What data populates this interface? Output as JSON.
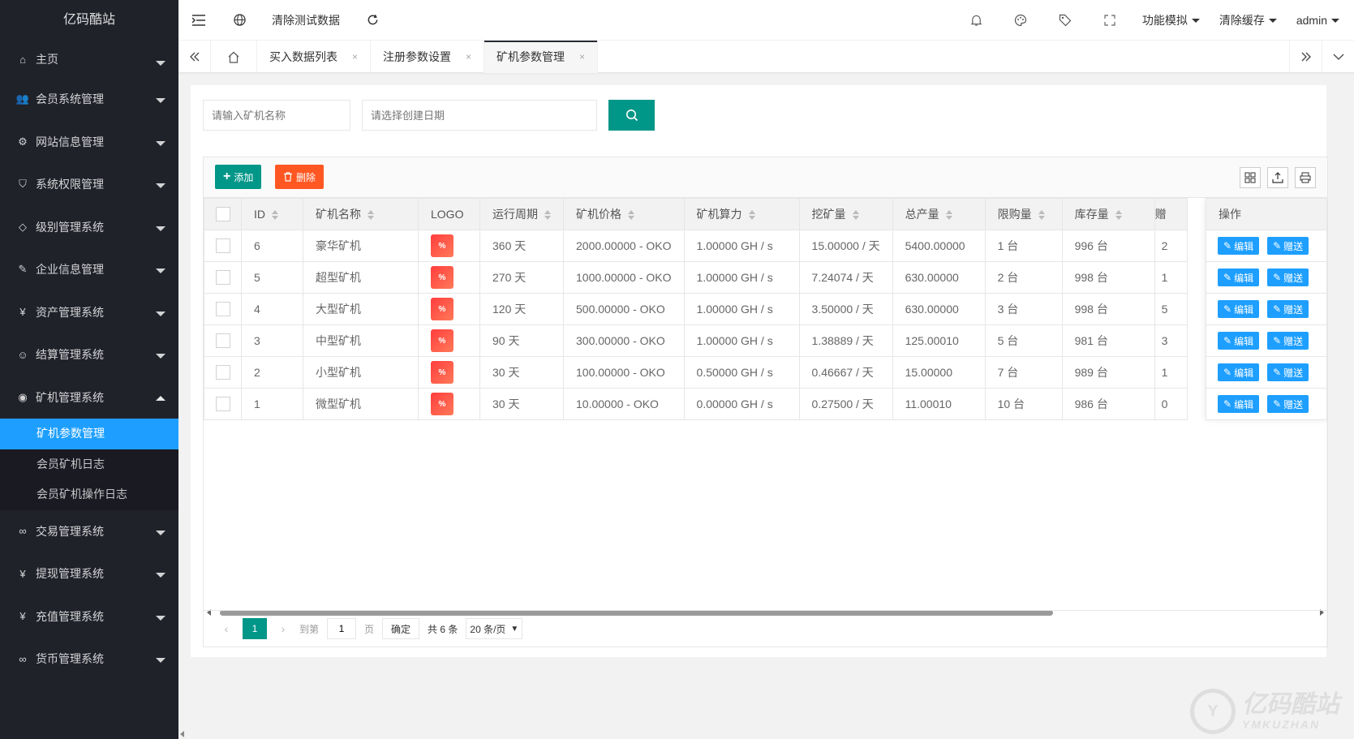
{
  "sidebar": {
    "logo": "亿码酷站",
    "items": [
      {
        "label": "主页",
        "icon": "home-icon"
      },
      {
        "label": "会员系统管理",
        "icon": "users-icon"
      },
      {
        "label": "网站信息管理",
        "icon": "gear-icon"
      },
      {
        "label": "系统权限管理",
        "icon": "shield-icon"
      },
      {
        "label": "级别管理系统",
        "icon": "diamond-icon"
      },
      {
        "label": "企业信息管理",
        "icon": "edit-doc-icon"
      },
      {
        "label": "资产管理系统",
        "icon": "yen-icon"
      },
      {
        "label": "结算管理系统",
        "icon": "smile-icon"
      },
      {
        "label": "矿机管理系统",
        "icon": "globe-icon"
      },
      {
        "label": "交易管理系统",
        "icon": "infinity-icon"
      },
      {
        "label": "提现管理系统",
        "icon": "yen-icon"
      },
      {
        "label": "充值管理系统",
        "icon": "yen-icon"
      },
      {
        "label": "货币管理系统",
        "icon": "infinity-icon"
      }
    ],
    "submenu": [
      "矿机参数管理",
      "会员矿机日志",
      "会员矿机操作日志"
    ]
  },
  "header": {
    "clear_test_data": "清除测试数据",
    "func_sim": "功能模拟",
    "clear_cache": "清除缓存",
    "user": "admin"
  },
  "tabs": [
    {
      "label": "买入数据列表",
      "close": "×"
    },
    {
      "label": "注册参数设置",
      "close": "×"
    },
    {
      "label": "矿机参数管理",
      "close": "×"
    }
  ],
  "search": {
    "name_placeholder": "请输入矿机名称",
    "date_placeholder": "请选择创建日期"
  },
  "toolbar": {
    "add": "添加",
    "delete": "删除"
  },
  "table": {
    "headers": [
      "ID",
      "矿机名称",
      "LOGO",
      "运行周期",
      "矿机价格",
      "矿机算力",
      "挖矿量",
      "总产量",
      "限购量",
      "库存量",
      "赠"
    ],
    "op_header": "操作",
    "rows": [
      [
        "6",
        "豪华矿机",
        "",
        "360 天",
        "2000.00000 - OKO",
        "1.00000 GH / s",
        "15.00000 / 天",
        "5400.00000",
        "1 台",
        "996 台",
        "2"
      ],
      [
        "5",
        "超型矿机",
        "",
        "270 天",
        "1000.00000 - OKO",
        "1.00000 GH / s",
        "7.24074 / 天",
        "630.00000",
        "2 台",
        "998 台",
        "1"
      ],
      [
        "4",
        "大型矿机",
        "",
        "120 天",
        "500.00000 - OKO",
        "1.00000 GH / s",
        "3.50000 / 天",
        "630.00000",
        "3 台",
        "998 台",
        "5"
      ],
      [
        "3",
        "中型矿机",
        "",
        "90 天",
        "300.00000 - OKO",
        "1.00000 GH / s",
        "1.38889 / 天",
        "125.00010",
        "5 台",
        "981 台",
        "3"
      ],
      [
        "2",
        "小型矿机",
        "",
        "30 天",
        "100.00000 - OKO",
        "0.50000 GH / s",
        "0.46667 / 天",
        "15.00000",
        "7 台",
        "989 台",
        "1"
      ],
      [
        "1",
        "微型矿机",
        "",
        "30 天",
        "10.00000 - OKO",
        "0.00000 GH / s",
        "0.27500 / 天",
        "11.00010",
        "10 台",
        "986 台",
        "0"
      ]
    ],
    "edit_label": "编辑",
    "gift_label": "赠送"
  },
  "pager": {
    "current": "1",
    "goto_prefix": "到第",
    "goto_value": "1",
    "goto_suffix": "页",
    "confirm": "确定",
    "total": "共 6 条",
    "per_page": "20 条/页"
  },
  "watermark": {
    "cn": "亿码酷站",
    "en": "YMKUZHAN"
  },
  "colors": {
    "sidebar": "#20222a",
    "accent": "#009688",
    "blue": "#1e9fff",
    "danger": "#ff5722"
  }
}
